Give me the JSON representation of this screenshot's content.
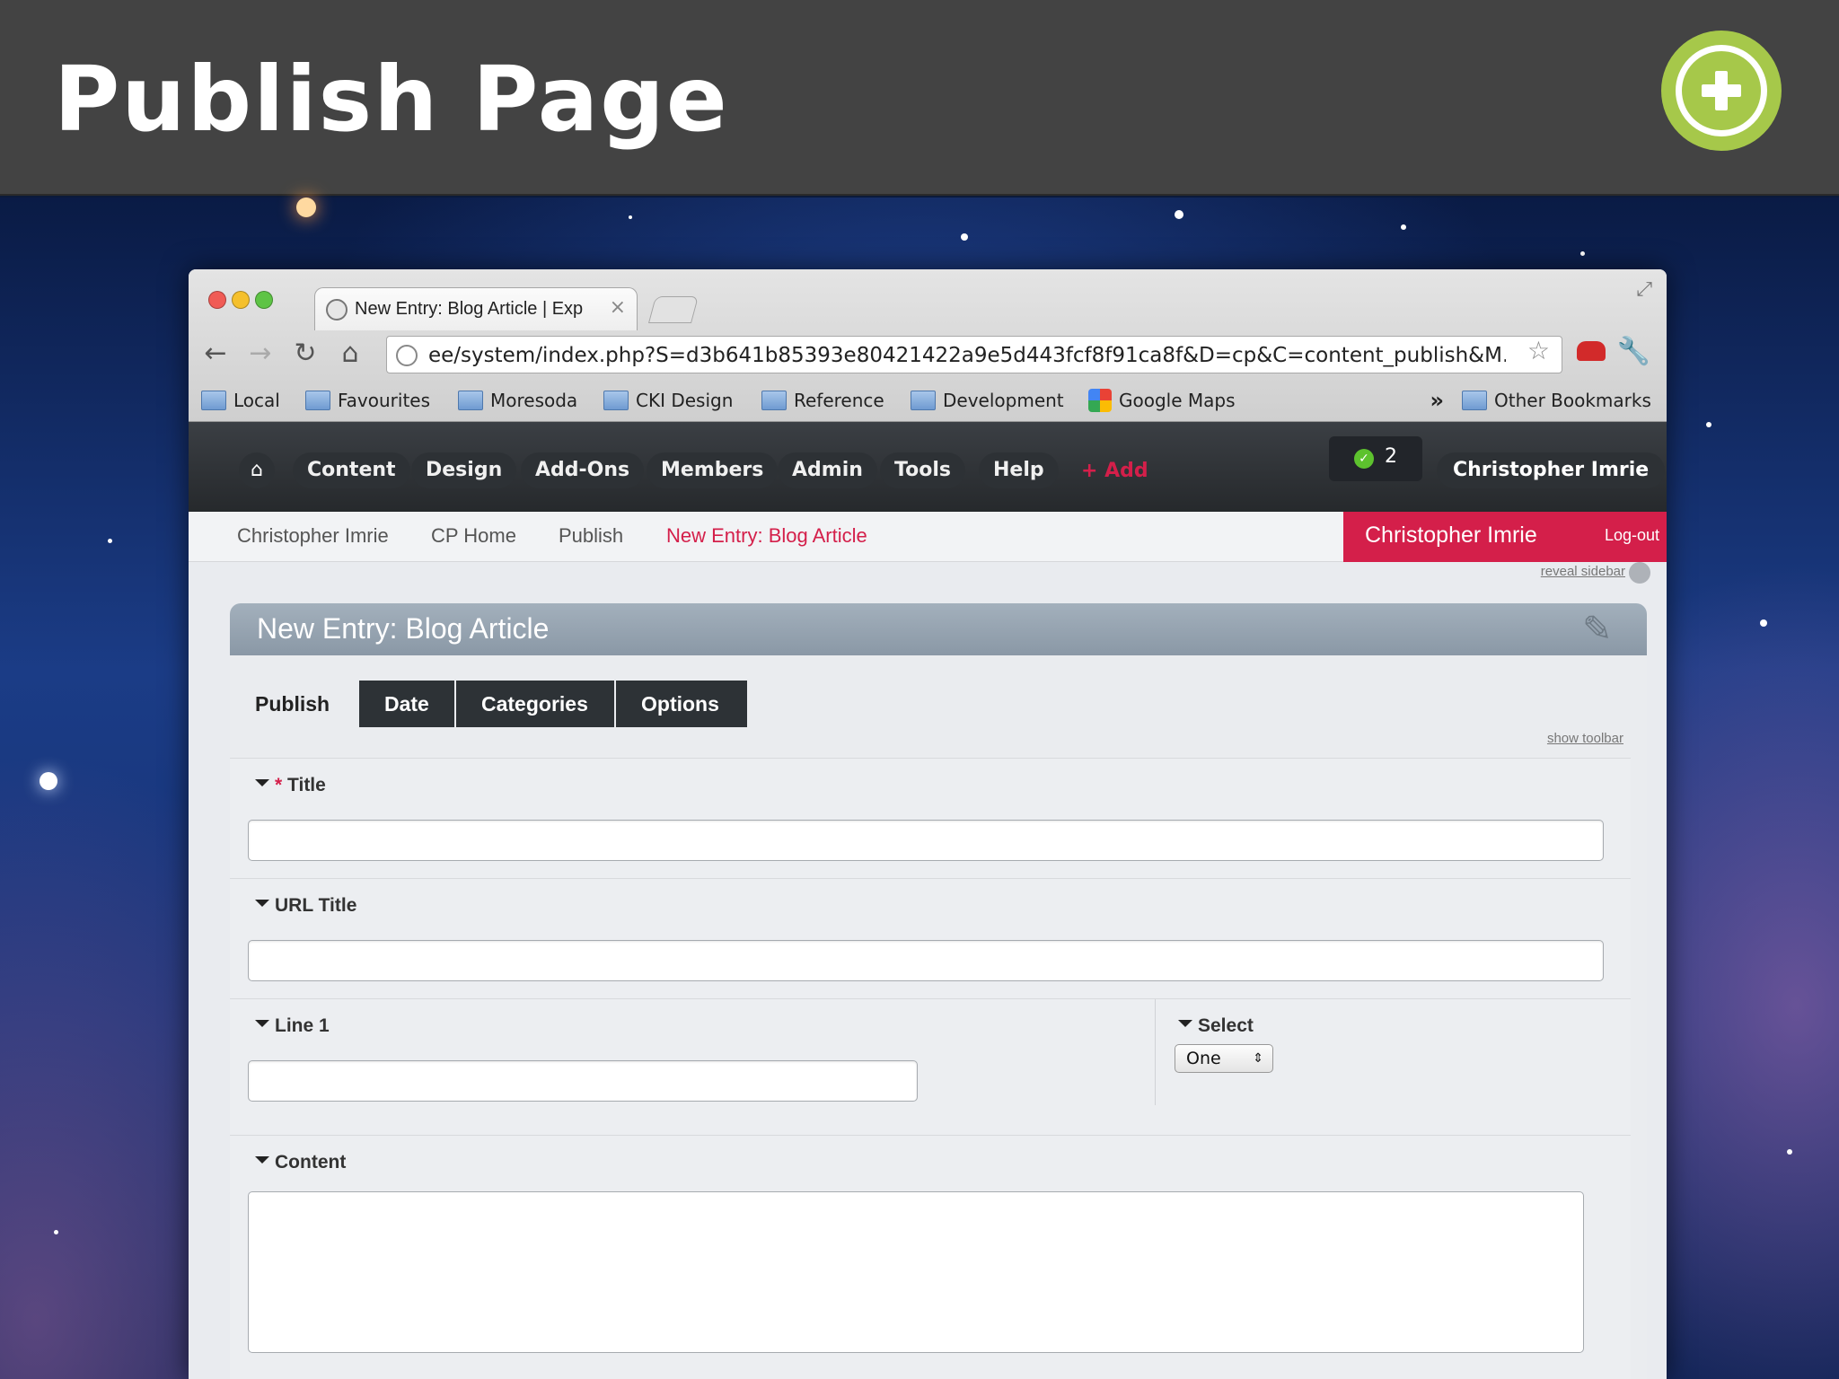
{
  "slide": {
    "title": "Publish Page"
  },
  "browser": {
    "tab_title": "New Entry: Blog Article | Exp",
    "url": "ee/system/index.php?S=d3b641b85393e80421422a9e5d443fcf8f91ca8f&D=cp&C=content_publish&M...",
    "bookmarks": [
      "Local",
      "Favourites",
      "Moresoda",
      "CKI Design",
      "Reference",
      "Development",
      "Google Maps"
    ],
    "bookmarks_overflow": "»",
    "other_bookmarks": "Other Bookmarks"
  },
  "ee_nav": {
    "items": [
      "Content",
      "Design",
      "Add-Ons",
      "Members",
      "Admin",
      "Tools",
      "Help"
    ],
    "add_label": "+ Add",
    "notification_count": "2",
    "user": "Christopher Imrie"
  },
  "breadcrumbs": [
    "Christopher Imrie",
    "CP Home",
    "Publish",
    "New Entry: Blog Article"
  ],
  "user_box": {
    "name": "Christopher Imrie",
    "logout": "Log-out"
  },
  "reveal_sidebar": "reveal sidebar",
  "panel": {
    "title": "New Entry: Blog Article",
    "tabs": [
      "Publish",
      "Date",
      "Categories",
      "Options"
    ],
    "show_toolbar": "show toolbar",
    "fields": {
      "title_label": "Title",
      "title_required_mark": "*",
      "url_title_label": "URL Title",
      "line1_label": "Line 1",
      "select_label": "Select",
      "select_value": "One",
      "content_label": "Content"
    }
  },
  "colors": {
    "accent": "#d41f4a",
    "badge_green": "#a6c84a",
    "nav_dark": "#2d3236"
  }
}
